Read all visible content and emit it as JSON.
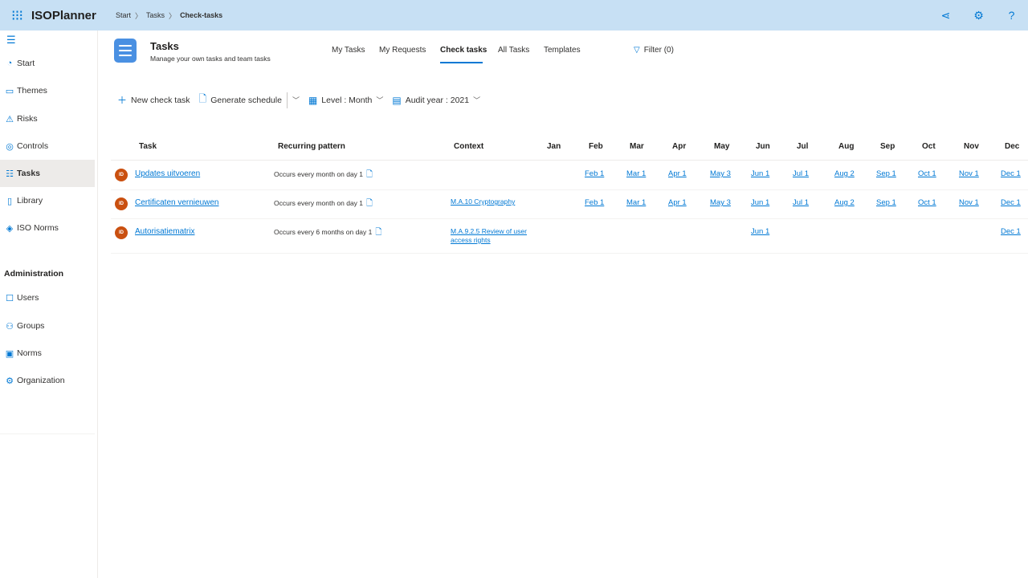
{
  "app": {
    "title": "ISOPlanner"
  },
  "breadcrumb": [
    "Start",
    "Tasks",
    "Check-tasks"
  ],
  "topbar_icons": [
    "share-icon",
    "gear-icon",
    "help-icon"
  ],
  "sidebar": {
    "items": [
      {
        "label": "Start",
        "icon": "start-icon"
      },
      {
        "label": "Themes",
        "icon": "themes-icon"
      },
      {
        "label": "Risks",
        "icon": "risks-icon"
      },
      {
        "label": "Controls",
        "icon": "controls-icon"
      },
      {
        "label": "Tasks",
        "icon": "tasks-icon",
        "active": true
      },
      {
        "label": "Library",
        "icon": "library-icon"
      },
      {
        "label": "ISO Norms",
        "icon": "iso-norms-icon"
      }
    ],
    "admin_heading": "Administration",
    "admin_items": [
      {
        "label": "Users",
        "icon": "users-icon"
      },
      {
        "label": "Groups",
        "icon": "groups-icon"
      },
      {
        "label": "Norms",
        "icon": "norms-icon"
      },
      {
        "label": "Organization",
        "icon": "organization-icon"
      }
    ]
  },
  "page": {
    "title": "Tasks",
    "subtitle": "Manage your own tasks and team tasks",
    "tabs": [
      "My Tasks",
      "My Requests",
      "Check tasks",
      "All Tasks",
      "Templates"
    ],
    "active_tab": "Check tasks",
    "filter_label": "Filter (0)"
  },
  "toolbar": {
    "new_label": "New check task",
    "generate_label": "Generate schedule",
    "level_label": "Level : Month",
    "audit_year_label": "Audit year : 2021"
  },
  "grid": {
    "headers": {
      "task": "Task",
      "pattern": "Recurring pattern",
      "context": "Context"
    },
    "months": [
      "Jan",
      "Feb",
      "Mar",
      "Apr",
      "May",
      "Jun",
      "Jul",
      "Aug",
      "Sep",
      "Oct",
      "Nov",
      "Dec"
    ],
    "rows": [
      {
        "avatar": "ID",
        "task": "Updates uitvoeren",
        "pattern": "Occurs every month on day 1",
        "context": "",
        "months": [
          "",
          "Feb 1",
          "Mar 1",
          "Apr 1",
          "May 3",
          "Jun 1",
          "Jul 1",
          "Aug 2",
          "Sep 1",
          "Oct 1",
          "Nov 1",
          "Dec 1"
        ]
      },
      {
        "avatar": "ID",
        "task": "Certificaten vernieuwen",
        "pattern": "Occurs every month on day 1",
        "context": "M.A.10 Cryptography",
        "months": [
          "",
          "Feb 1",
          "Mar 1",
          "Apr 1",
          "May 3",
          "Jun 1",
          "Jul 1",
          "Aug 2",
          "Sep 1",
          "Oct 1",
          "Nov 1",
          "Dec 1"
        ]
      },
      {
        "avatar": "ID",
        "task": "Autorisatiematrix",
        "pattern": "Occurs every 6 months on day 1",
        "context": "M.A.9.2.5 Review of user access rights",
        "months": [
          "",
          "",
          "",
          "",
          "",
          "Jun 1",
          "",
          "",
          "",
          "",
          "",
          "Dec 1"
        ]
      }
    ]
  },
  "colors": {
    "topbar": "#c7e0f4",
    "accent": "#0078d4",
    "avatar": "#ca5010"
  }
}
